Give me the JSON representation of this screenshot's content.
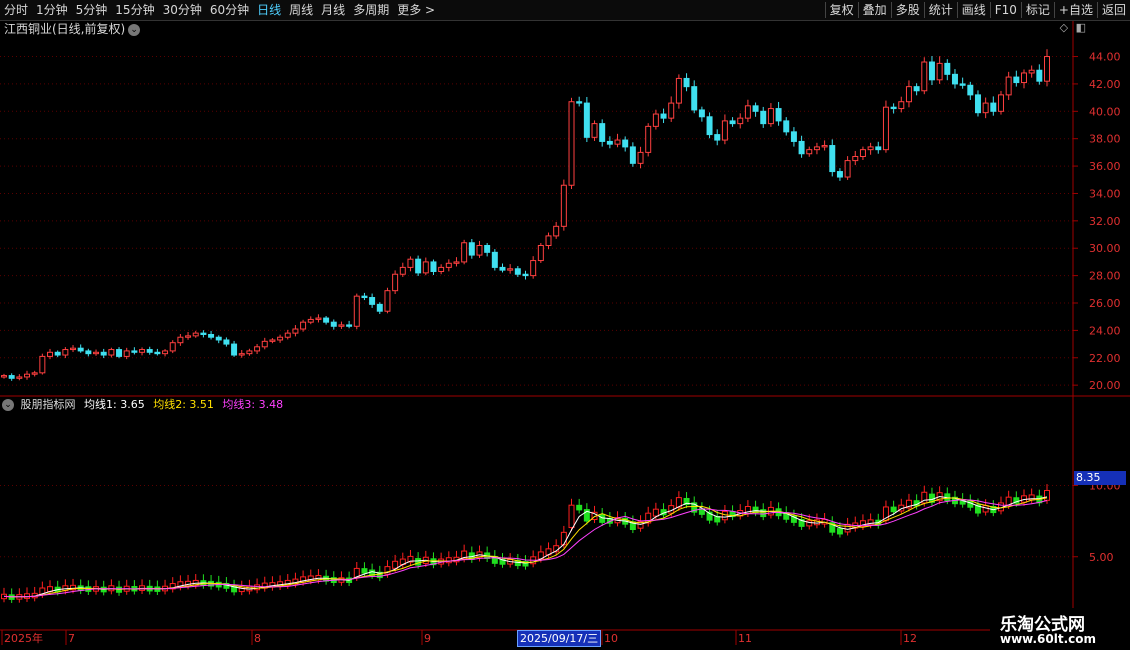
{
  "toolbar": {
    "left": [
      "分时",
      "1分钟",
      "5分钟",
      "15分钟",
      "30分钟",
      "60分钟",
      "日线",
      "周线",
      "月线",
      "多周期",
      "更多 >"
    ],
    "active": "日线",
    "right": [
      "复权",
      "叠加",
      "多股",
      "统计",
      "画线",
      "F10",
      "标记",
      "+自选",
      "返回"
    ]
  },
  "title": "江西铜业(日线,前复权)",
  "indicator": {
    "name": "股朋指标网",
    "ma1": "均线1: 3.65",
    "ma2": "均线2: 3.51",
    "ma3": "均线3: 3.48",
    "ma1_color": "#ffffff",
    "ma2_color": "#ffe000",
    "ma3_color": "#ff40ff",
    "current_value": "8.35"
  },
  "date_flag": "2025/09/17/三",
  "watermark": {
    "line1": "乐淘公式网",
    "line2": "www.60lt.com"
  },
  "chart_data": [
    {
      "type": "candlestick",
      "ylim": [
        19.5,
        45.5
      ],
      "ticks": [
        "44.00",
        "42.00",
        "40.00",
        "38.00",
        "36.00",
        "34.00",
        "32.00",
        "30.00",
        "28.00",
        "26.00",
        "24.00",
        "22.00",
        "20.00"
      ],
      "up_color": "#ff4040",
      "down_color": "#40e0f0",
      "closes": [
        20.7,
        20.5,
        20.6,
        20.8,
        20.9,
        22.1,
        22.4,
        22.2,
        22.6,
        22.7,
        22.5,
        22.3,
        22.4,
        22.2,
        22.6,
        22.1,
        22.5,
        22.4,
        22.6,
        22.4,
        22.3,
        22.5,
        23.1,
        23.5,
        23.6,
        23.8,
        23.7,
        23.5,
        23.3,
        23.0,
        22.2,
        22.3,
        22.5,
        22.8,
        23.2,
        23.3,
        23.5,
        23.8,
        24.1,
        24.6,
        24.8,
        24.9,
        24.6,
        24.3,
        24.4,
        24.3,
        26.5,
        26.4,
        25.9,
        25.4,
        26.9,
        28.1,
        28.6,
        29.2,
        28.2,
        29.0,
        28.3,
        28.6,
        28.9,
        29.0,
        30.4,
        29.5,
        30.2,
        29.7,
        28.6,
        28.4,
        28.5,
        28.1,
        28.0,
        29.1,
        30.2,
        30.9,
        31.6,
        34.6,
        40.7,
        40.6,
        38.1,
        39.1,
        37.8,
        37.6,
        37.9,
        37.4,
        36.2,
        37.0,
        38.9,
        39.8,
        39.5,
        40.6,
        42.4,
        41.8,
        40.1,
        39.6,
        38.3,
        37.9,
        39.3,
        39.1,
        39.5,
        40.4,
        40.0,
        39.1,
        40.2,
        39.3,
        38.5,
        37.8,
        36.9,
        37.2,
        37.4,
        37.5,
        35.6,
        35.2,
        36.4,
        36.7,
        37.2,
        37.4,
        37.2,
        40.3,
        40.2,
        40.7,
        41.8,
        41.5,
        43.6,
        42.3,
        43.5,
        42.7,
        42.0,
        41.9,
        41.2,
        39.9,
        40.6,
        40.0,
        41.2,
        42.5,
        42.1,
        42.8,
        43.0,
        42.2,
        44.0
      ]
    },
    {
      "type": "line",
      "ylim": [
        0,
        16
      ],
      "ticks": [
        "10.00",
        "5.00"
      ],
      "series": [
        {
          "name": "均线1",
          "values": [
            3.65
          ]
        },
        {
          "name": "均线2",
          "values": [
            3.51
          ]
        },
        {
          "name": "均线3",
          "values": [
            3.48
          ]
        }
      ]
    }
  ],
  "x_axis": {
    "labels": [
      "2025年",
      "7",
      "8",
      "9",
      "10",
      "11",
      "12"
    ]
  }
}
